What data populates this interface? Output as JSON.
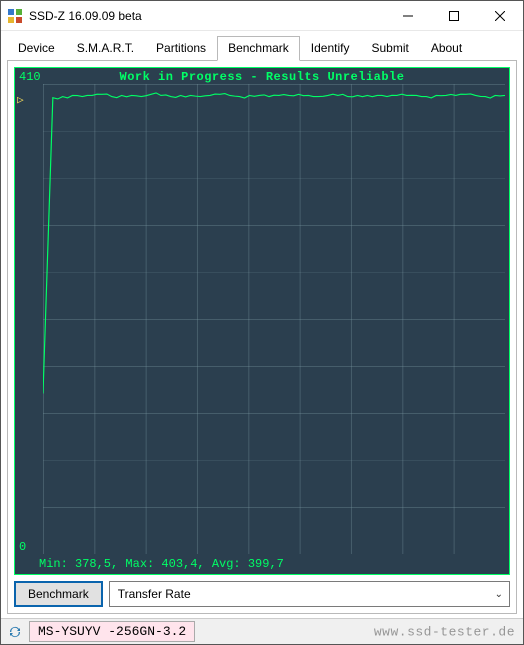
{
  "window": {
    "title": "SSD-Z 16.09.09 beta"
  },
  "tabs": [
    "Device",
    "S.M.A.R.T.",
    "Partitions",
    "Benchmark",
    "Identify",
    "Submit",
    "About"
  ],
  "active_tab": "Benchmark",
  "chart": {
    "title": "Work in Progress - Results Unreliable",
    "y_max_label": "410",
    "y_min_label": "0",
    "stats": "Min: 378,5, Max: 403,4, Avg: 399,7"
  },
  "chart_data": {
    "type": "line",
    "title": "Work in Progress - Results Unreliable",
    "xlabel": "",
    "ylabel": "",
    "ylim": [
      0,
      410
    ],
    "series": [
      {
        "name": "Transfer Rate",
        "values": [
          140,
          398,
          399,
          400,
          399,
          400,
          401,
          399,
          400,
          400,
          399,
          401,
          400,
          399,
          400,
          400,
          399,
          400,
          401,
          400,
          399,
          400,
          400,
          399,
          400,
          400,
          401,
          400,
          399,
          400,
          400,
          399,
          400,
          400,
          400,
          399,
          400,
          400,
          400,
          399,
          400,
          400,
          400,
          401,
          400,
          399,
          400,
          400
        ]
      }
    ],
    "stats": {
      "min": 378.5,
      "max": 403.4,
      "avg": 399.7
    }
  },
  "buttons": {
    "benchmark": "Benchmark"
  },
  "mode": {
    "selected": "Transfer Rate"
  },
  "status": {
    "drive": "MS-YSUYV -256GN-3.2",
    "watermark": "www.ssd-tester.de"
  }
}
